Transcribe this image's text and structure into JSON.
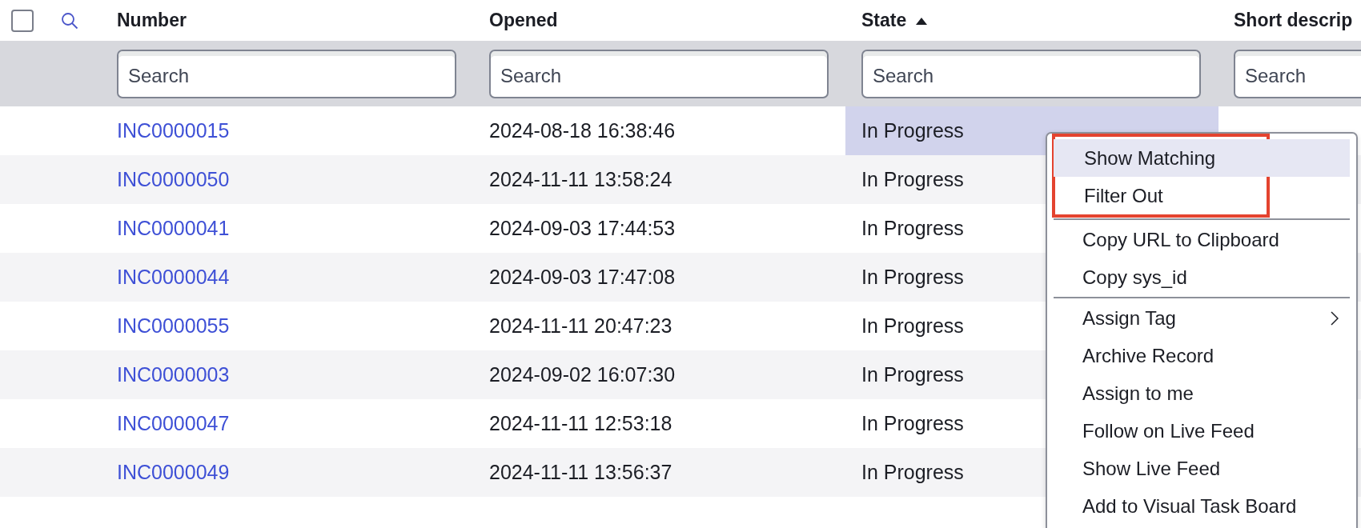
{
  "header": {
    "select_all": {
      "checked": false
    },
    "columns": [
      {
        "label": "Number",
        "sorted": false
      },
      {
        "label": "Opened",
        "sorted": false
      },
      {
        "label": "State",
        "sorted": true
      },
      {
        "label": "Short descrip",
        "sorted": false
      }
    ]
  },
  "search_row": [
    {
      "placeholder": "Search"
    },
    {
      "placeholder": "Search"
    },
    {
      "placeholder": "Search"
    },
    {
      "placeholder": "Search"
    }
  ],
  "rows": [
    {
      "cells": [
        {
          "text": "INC0000015",
          "selected": false
        },
        {
          "text": "2024-08-18 16:38:46",
          "selected": false
        },
        {
          "text": "In Progress",
          "selected": true
        }
      ]
    },
    {
      "cells": [
        {
          "text": "INC0000050",
          "selected": false
        },
        {
          "text": "2024-11-11 13:58:24",
          "selected": false
        },
        {
          "text": "In Progress",
          "selected": false
        }
      ]
    },
    {
      "cells": [
        {
          "text": "INC0000041",
          "selected": false
        },
        {
          "text": "2024-09-03 17:44:53",
          "selected": false
        },
        {
          "text": "In Progress",
          "selected": false
        }
      ]
    },
    {
      "cells": [
        {
          "text": "INC0000044",
          "selected": false
        },
        {
          "text": "2024-09-03 17:47:08",
          "selected": false
        },
        {
          "text": "In Progress",
          "selected": false
        }
      ]
    },
    {
      "cells": [
        {
          "text": "INC0000055",
          "selected": false
        },
        {
          "text": "2024-11-11 20:47:23",
          "selected": false
        },
        {
          "text": "In Progress",
          "selected": false
        }
      ]
    },
    {
      "cells": [
        {
          "text": "INC0000003",
          "selected": false
        },
        {
          "text": "2024-09-02 16:07:30",
          "selected": false
        },
        {
          "text": "In Progress",
          "selected": false
        }
      ]
    },
    {
      "cells": [
        {
          "text": "INC0000047",
          "selected": false
        },
        {
          "text": "2024-11-11 12:53:18",
          "selected": false
        },
        {
          "text": "In Progress",
          "selected": false
        }
      ]
    },
    {
      "cells": [
        {
          "text": "INC0000049",
          "selected": false
        },
        {
          "text": "2024-11-11 13:56:37",
          "selected": false
        },
        {
          "text": "In Progress",
          "selected": false
        }
      ]
    }
  ],
  "context_menu": {
    "sections": [
      {
        "annotated": true,
        "items": [
          {
            "label": "Show Matching",
            "selected": true,
            "submenu": false
          },
          {
            "label": "Filter Out",
            "selected": false,
            "submenu": false
          }
        ]
      },
      {
        "annotated": false,
        "items": [
          {
            "label": "Copy URL to Clipboard",
            "selected": false,
            "submenu": false
          },
          {
            "label": "Copy sys_id",
            "selected": false,
            "submenu": false
          }
        ]
      },
      {
        "annotated": false,
        "items": [
          {
            "label": "Assign Tag",
            "selected": false,
            "submenu": true
          },
          {
            "label": "Archive Record",
            "selected": false,
            "submenu": false
          },
          {
            "label": "Assign to me",
            "selected": false,
            "submenu": false
          },
          {
            "label": "Follow on Live Feed",
            "selected": false,
            "submenu": false
          },
          {
            "label": "Show Live Feed",
            "selected": false,
            "submenu": false
          },
          {
            "label": "Add to Visual Task Board",
            "selected": false,
            "submenu": false
          }
        ]
      }
    ]
  }
}
